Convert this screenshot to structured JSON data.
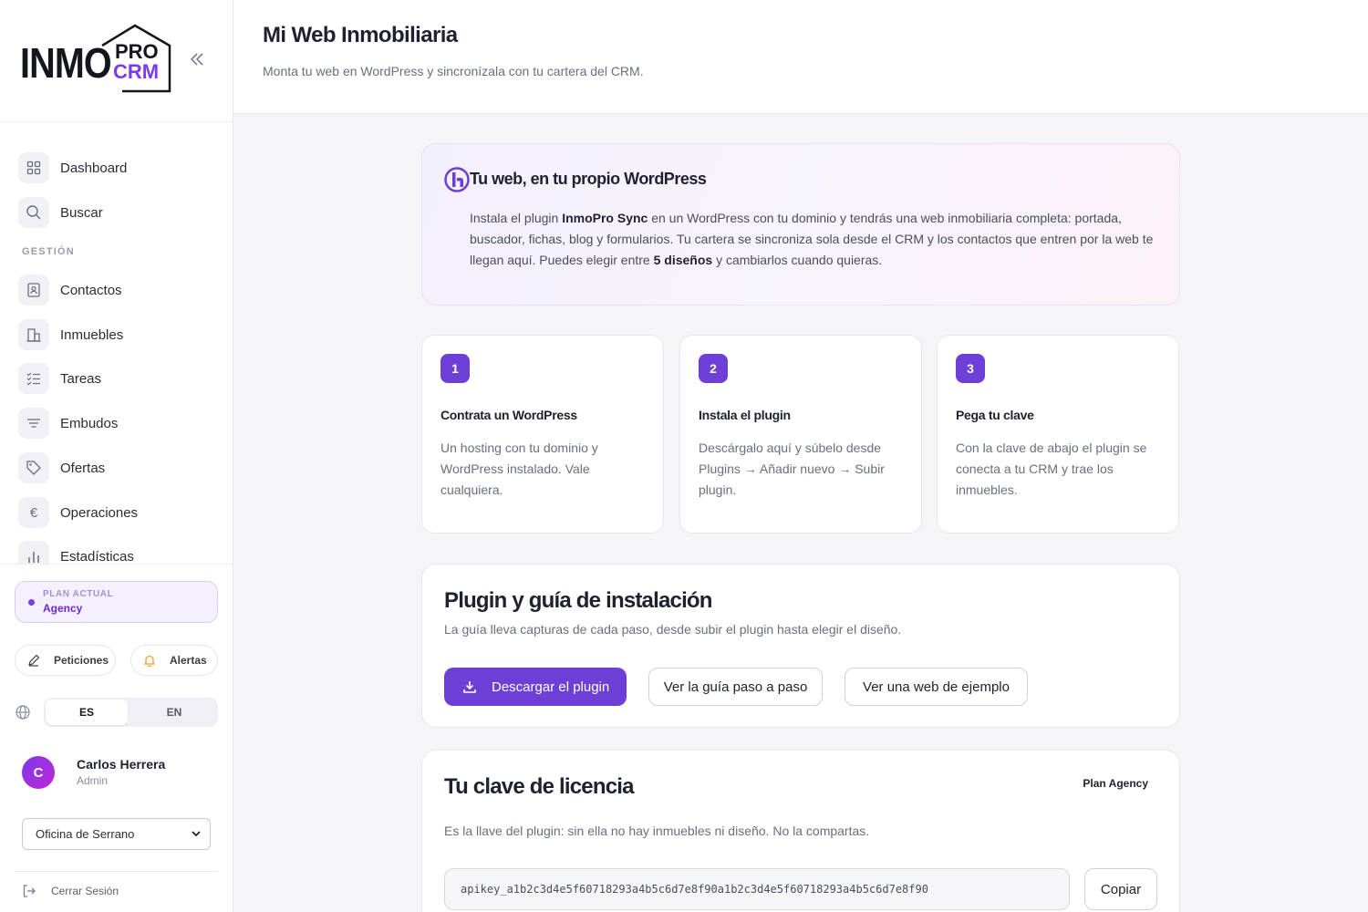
{
  "brand": {
    "logo_main": "INMO",
    "logo_pro": "PRO",
    "logo_crm": "CRM"
  },
  "sidebar": {
    "collapse_icon": "double-chevron-left-icon",
    "nav": [
      {
        "label": "Dashboard",
        "icon": "grid-icon"
      },
      {
        "label": "Buscar",
        "icon": "search-icon"
      },
      {
        "label": "Contactos",
        "icon": "contact-book-icon"
      },
      {
        "label": "Inmuebles",
        "icon": "building-icon"
      },
      {
        "label": "Tareas",
        "icon": "checklist-icon"
      },
      {
        "label": "Embudos",
        "icon": "funnel-icon"
      },
      {
        "label": "Ofertas",
        "icon": "tag-icon"
      },
      {
        "label": "Operaciones",
        "icon": "euro-icon"
      },
      {
        "label": "Estadísticas",
        "icon": "bar-chart-icon"
      }
    ],
    "section_gestion": "GESTIÓN",
    "plan": {
      "label": "PLAN ACTUAL",
      "value": "Agency"
    },
    "peticiones_label": "Peticiones",
    "alertas_label": "Alertas",
    "lang": {
      "es": "ES",
      "en": "EN",
      "active": "ES"
    },
    "user": {
      "initial": "C",
      "name": "Carlos Herrera",
      "role": "Admin"
    },
    "office": {
      "selected": "Oficina de Serrano"
    },
    "logout_label": "Cerrar Sesión"
  },
  "header": {
    "title": "Mi Web Inmobiliaria",
    "subtitle": "Monta tu web en WordPress y sincronízala con tu cartera del CRM."
  },
  "intro": {
    "title": "Tu web, en tu propio WordPress",
    "text_1": "Instala el plugin ",
    "plugin_name": "InmoPro Sync",
    "text_2": " en un WordPress con tu dominio y tendrás una web inmobiliaria completa: portada, buscador, fichas, blog y formularios. Tu cartera se sincroniza sola desde el CRM y los contactos que entren por la web te llegan aquí. Puedes elegir entre ",
    "designs": "5 diseños",
    "text_3": " y cambiarlos cuando quieras."
  },
  "steps": [
    {
      "num": "1",
      "title": "Contrata un WordPress",
      "desc": "Un hosting con tu dominio y WordPress instalado. Vale cualquiera."
    },
    {
      "num": "2",
      "title": "Instala el plugin",
      "desc": "Descárgalo aquí y súbelo desde Plugins → Añadir nuevo → Subir plugin."
    },
    {
      "num": "3",
      "title": "Pega tu clave",
      "desc": "Con la clave de abajo el plugin se conecta a tu CRM y trae los inmuebles."
    }
  ],
  "plugin": {
    "title": "Plugin y guía de instalación",
    "subtitle": "La guía lleva capturas de cada paso, desde subir el plugin hasta elegir el diseño.",
    "download_label": "Descargar el plugin",
    "guide_label": "Ver la guía paso a paso",
    "example_label": "Ver una web de ejemplo"
  },
  "license": {
    "title": "Tu clave de licencia",
    "badge": "Plan Agency",
    "subtitle": "Es la llave del plugin: sin ella no hay inmuebles ni diseño. No la compartas.",
    "key": "apikey_a1b2c3d4e5f60718293a4b5c6d7e8f90a1b2c3d4e5f60718293a4b5c6d7e8f90",
    "copy_label": "Copiar"
  },
  "colors": {
    "accent": "#6d3fd6",
    "accent_light": "#f5f0ff",
    "text": "#1f2130",
    "muted": "#6b6e80"
  }
}
